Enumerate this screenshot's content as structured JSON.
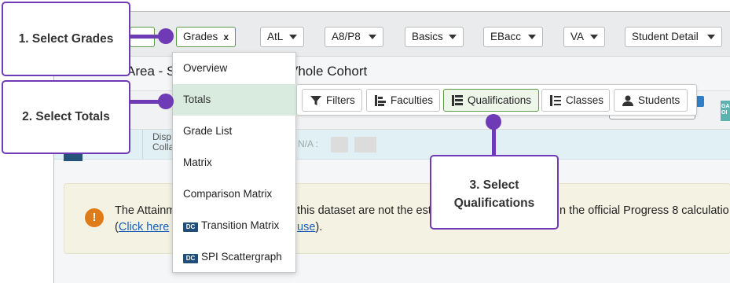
{
  "callouts": {
    "step1": "1. Select Grades",
    "step2": "2. Select Totals",
    "step3_line1": "3. Select",
    "step3_line2": "Qualifications"
  },
  "topbar": {
    "filters": [
      {
        "label": "Grades",
        "suffix": "x"
      },
      {
        "label": "AtL"
      },
      {
        "label": "A8/P8"
      },
      {
        "label": "Basics"
      },
      {
        "label": "EBacc"
      },
      {
        "label": "VA"
      },
      {
        "label": "Student Detail"
      }
    ]
  },
  "page": {
    "title_left": "Area - S",
    "title_right": "Vhole Cohort"
  },
  "menu": {
    "items": [
      {
        "label": "Overview"
      },
      {
        "label": "Totals"
      },
      {
        "label": "Grade List"
      },
      {
        "label": "Matrix"
      },
      {
        "label": "Comparison Matrix"
      },
      {
        "label": "Transition Matrix",
        "badge": "DC"
      },
      {
        "label": "SPI Scattergraph",
        "badge": "DC"
      }
    ]
  },
  "toolbar": {
    "buttons": [
      {
        "label": "Filters",
        "icon": "filter-icon"
      },
      {
        "label": "Faculties",
        "icon": "faculties-icon"
      },
      {
        "label": "Qualifications",
        "icon": "qualifications-icon",
        "selected": true
      },
      {
        "label": "Classes",
        "icon": "classes-icon"
      },
      {
        "label": "Students",
        "icon": "user-icon"
      }
    ]
  },
  "strip": {
    "disp_line1": "Disp",
    "disp_line2": "Colla",
    "na_label": "N/A :",
    "side_tag": "GA OI"
  },
  "alert": {
    "icon": "!",
    "text_a": "The Attainm",
    "text_b": "this dataset are not the est",
    "text_c": "n the official Progress 8 calculatio",
    "link_open": "(",
    "link_text": "Click here",
    "link_text_2": "use",
    "close": ")."
  },
  "colors": {
    "callout_border": "#6e3ab5",
    "menu_highlight": "#d8ebde",
    "selected_border": "#5b9b48",
    "alert_icon": "#e07b1a"
  }
}
